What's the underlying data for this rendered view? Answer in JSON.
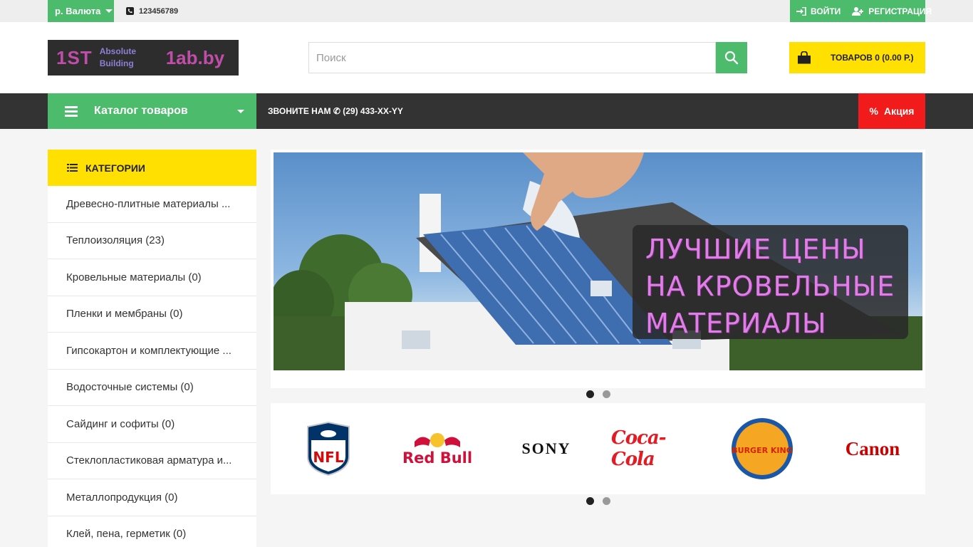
{
  "topbar": {
    "currency_label": "р. Валюта",
    "phone": "123456789",
    "login_label": "ВОЙТИ",
    "register_label": "РЕГИСТРАЦИЯ"
  },
  "header": {
    "logo": {
      "part1": "1ST",
      "part2_line1": "Absolute",
      "part2_line2": "Building",
      "part3": "1ab.by"
    },
    "search_placeholder": "Поиск",
    "cart_label": "ТОВАРОВ 0 (0.00 Р.)"
  },
  "nav": {
    "catalog_label": "Каталог товаров",
    "call_us": "ЗВОНИТЕ НАМ ✆ (29) 433-XX-YY",
    "sale_label": "Акция"
  },
  "sidebar": {
    "title": "КАТЕГОРИИ",
    "items": [
      "Древесно-плитные материалы ...",
      "Теплоизоляция (23)",
      "Кровельные материалы (0)",
      "Пленки и мембраны (0)",
      "Гипсокартон и комплектующие ...",
      "Водосточные системы (0)",
      "Сайдинг и софиты (0)",
      "Стеклопластиковая арматура и...",
      "Металлопродукция (0)",
      "Клей, пена, герметик (0)"
    ]
  },
  "banner": {
    "line1": "ЛУЧШИЕ ЦЕНЫ",
    "line2": "НА КРОВЕЛЬНЫЕ",
    "line3": "МАТЕРИАЛЫ"
  },
  "brands": [
    "NFL",
    "Red Bull",
    "SONY",
    "Coca-Cola",
    "BURGER KING",
    "Canon"
  ],
  "colors": {
    "green": "#4cbb6c",
    "yellow": "#ffe000",
    "dark": "#333333",
    "red": "#f21b1b"
  }
}
